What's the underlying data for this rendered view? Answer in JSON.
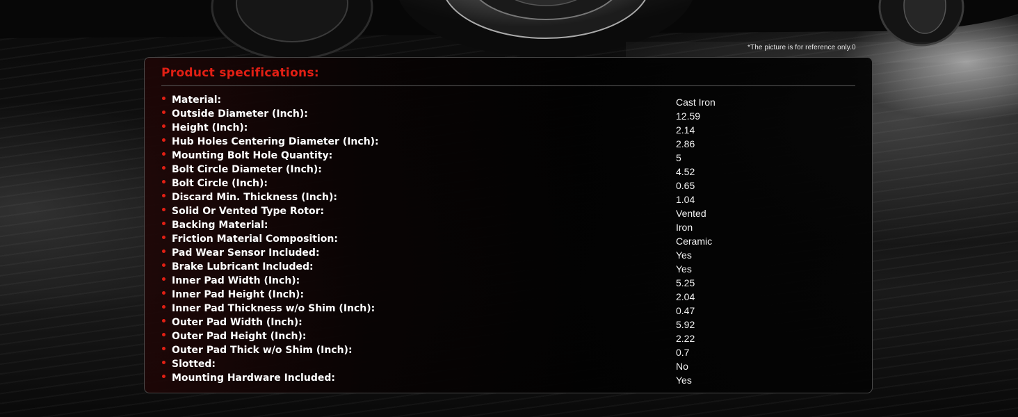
{
  "reference_note": "*The picture is for reference only.0",
  "panel": {
    "title": "Product specifications:"
  },
  "specs": [
    {
      "label": "Material:",
      "value": "Cast Iron"
    },
    {
      "label": "Outside Diameter (Inch):",
      "value": "12.59"
    },
    {
      "label": "Height (Inch):",
      "value": "2.14"
    },
    {
      "label": "Hub Holes Centering Diameter (Inch):",
      "value": "2.86"
    },
    {
      "label": "Mounting Bolt Hole Quantity:",
      "value": "5"
    },
    {
      "label": "Bolt Circle Diameter (Inch):",
      "value": "4.52"
    },
    {
      "label": "Bolt Circle (Inch):",
      "value": "0.65"
    },
    {
      "label": "Discard Min. Thickness (Inch):",
      "value": "1.04"
    },
    {
      "label": "Solid Or Vented Type Rotor:",
      "value": "Vented"
    },
    {
      "label": "Backing Material:",
      "value": "Iron"
    },
    {
      "label": "Friction Material Composition:",
      "value": "Ceramic"
    },
    {
      "label": "Pad Wear Sensor Included:",
      "value": "Yes"
    },
    {
      "label": "Brake Lubricant Included:",
      "value": "Yes"
    },
    {
      "label": "Inner Pad Width (Inch):",
      "value": "5.25"
    },
    {
      "label": "Inner Pad Height (Inch):",
      "value": "2.04"
    },
    {
      "label": "Inner Pad Thickness w/o Shim (Inch):",
      "value": "0.47"
    },
    {
      "label": "Outer Pad Width (Inch):",
      "value": "5.92"
    },
    {
      "label": "Outer Pad Height (Inch):",
      "value": "2.22"
    },
    {
      "label": "Outer Pad Thick w/o Shim (Inch):",
      "value": "0.7"
    },
    {
      "label": "Slotted:",
      "value": "No"
    },
    {
      "label": "Mounting Hardware Included:",
      "value": "Yes"
    }
  ],
  "colors": {
    "accent": "#e21f14",
    "text": "#ffffff",
    "panel_border": "#4a4a4a"
  }
}
